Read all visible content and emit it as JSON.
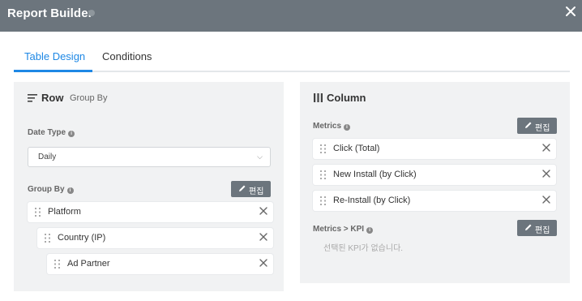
{
  "window": {
    "title": "Report Builder"
  },
  "tabs": [
    "Table Design",
    "Conditions"
  ],
  "row_panel": {
    "title": "Row",
    "subtitle": "Group By",
    "date_type_label": "Date Type",
    "date_type_value": "Daily",
    "group_by_label": "Group By",
    "edit_label": "편집",
    "items": [
      "Platform",
      "Country (IP)",
      "Ad Partner"
    ]
  },
  "column_panel": {
    "title": "Column",
    "metrics_label": "Metrics",
    "edit_label": "편집",
    "metrics": [
      "Click (Total)",
      "New Install (by Click)",
      "Re-Install (by Click)"
    ],
    "kpi_label": "Metrics > KPI",
    "kpi_edit_label": "편집",
    "kpi_empty": "선택된 KPI가 없습니다."
  },
  "colors": {
    "header": "#6c757d",
    "accent": "#1e88e5",
    "panel": "#f1f2f3",
    "button": "#6c757d"
  }
}
